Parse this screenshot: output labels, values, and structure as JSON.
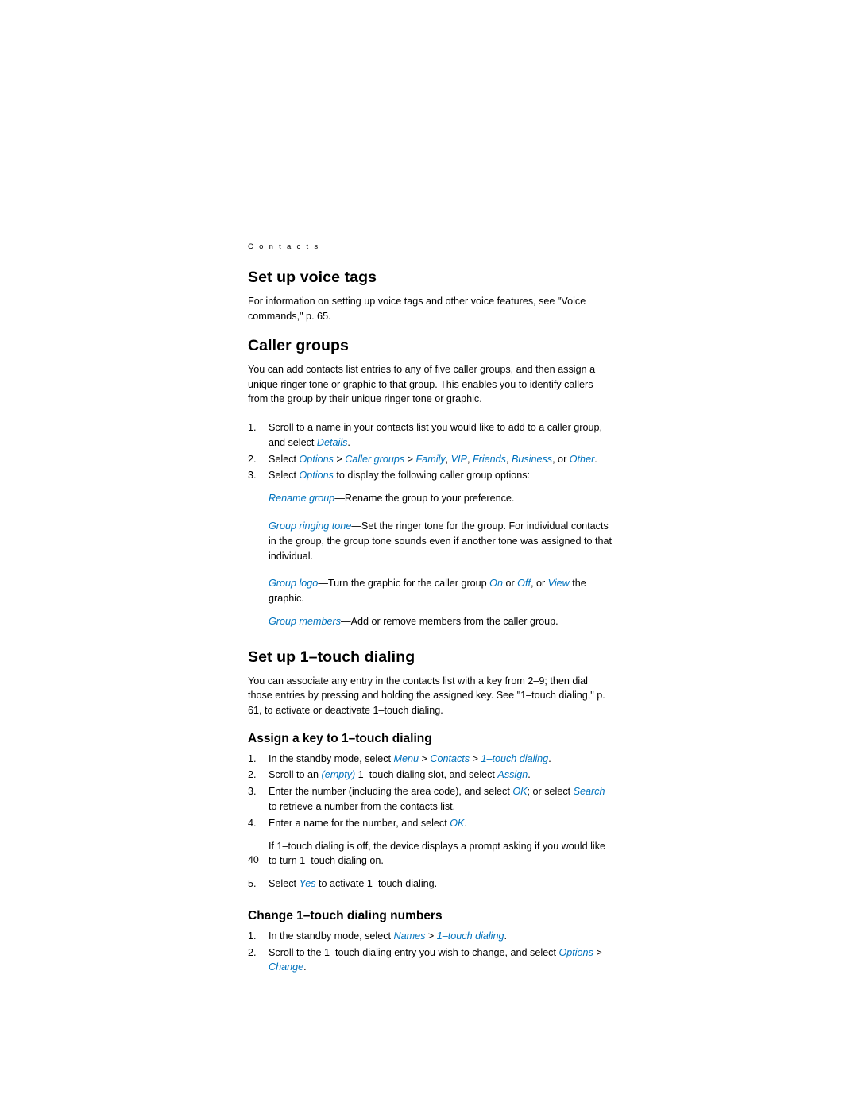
{
  "page": {
    "running_head": "C o n t a c t s",
    "folio": "40",
    "accent_color": "#0072bc"
  },
  "sections": {
    "voice_tags": {
      "title": "Set up voice tags",
      "body": "For information on setting up voice tags and other voice features, see \"Voice commands,\" p. 65."
    },
    "caller_groups": {
      "title": "Caller groups",
      "body": "You can add contacts list entries to any of five caller groups, and then assign a unique ringer tone or graphic to that group. This enables you to identify callers from the group by their unique ringer tone or graphic.",
      "step1": {
        "num": "1.",
        "a": "Scroll to a name in your contacts list you would like to add to a caller group, and select ",
        "link": "Details",
        "b": "."
      },
      "step2": {
        "num": "2.",
        "a": "Select ",
        "l1": "Options",
        "sep1": " > ",
        "l2": "Caller groups",
        "sep2": " > ",
        "l3": "Family",
        "c1": ", ",
        "l4": "VIP",
        "c2": ", ",
        "l5": "Friends",
        "c3": ", ",
        "l6": "Business",
        "c4": ", or ",
        "l7": "Other",
        "end": "."
      },
      "step3": {
        "num": "3.",
        "a": "Select ",
        "link": "Options",
        "b": " to display the following caller group options:"
      },
      "opt_rename": {
        "link": "Rename group",
        "text": "—Rename the group to your preference."
      },
      "opt_ringing": {
        "link": "Group ringing tone",
        "text": "—Set the ringer tone for the group. For individual contacts in the group, the group tone sounds even if another tone was assigned to that individual."
      },
      "opt_logo": {
        "link": "Group logo",
        "a": "—Turn the graphic for the caller group ",
        "l1": "On",
        "b": " or ",
        "l2": "Off",
        "c": ", or ",
        "l3": "View",
        "d": " the graphic."
      },
      "opt_members": {
        "link": "Group members",
        "text": "—Add or remove members from the caller group."
      }
    },
    "one_touch": {
      "title": "Set up 1–touch dialing",
      "body": "You can associate any entry in the contacts list with a key from 2–9; then dial those entries by pressing and holding the assigned key. See \"1–touch dialing,\" p. 61, to activate or deactivate 1–touch dialing.",
      "assign": {
        "title": "Assign a key to 1–touch dialing",
        "step1": {
          "num": "1.",
          "a": "In the standby mode, select ",
          "l1": "Menu",
          "s1": " > ",
          "l2": "Contacts",
          "s2": " > ",
          "l3": "1–touch dialing",
          "end": "."
        },
        "step2": {
          "num": "2.",
          "a": "Scroll to an ",
          "l1": "(empty)",
          "b": " 1–touch dialing slot, and select ",
          "l2": "Assign",
          "end": "."
        },
        "step3": {
          "num": "3.",
          "a": "Enter the number (including the area code), and select ",
          "l1": "OK",
          "b": "; or select ",
          "l2": "Search",
          "c": " to retrieve a number from the contacts list."
        },
        "step4": {
          "num": "4.",
          "a": "Enter a name for the number, and select ",
          "l1": "OK",
          "end": "."
        },
        "note": "If 1–touch dialing is off, the device displays a prompt asking if you would like to turn 1–touch dialing on.",
        "step5": {
          "num": "5.",
          "a": "Select ",
          "l1": "Yes",
          "b": " to activate 1–touch dialing."
        }
      },
      "change": {
        "title": "Change 1–touch dialing numbers",
        "step1": {
          "num": "1.",
          "a": "In the standby mode, select ",
          "l1": "Names",
          "s1": " > ",
          "l2": "1–touch dialing",
          "end": "."
        },
        "step2": {
          "num": "2.",
          "a": "Scroll to the 1–touch dialing entry you wish to change, and select ",
          "l1": "Options",
          "s1": " > ",
          "l2": "Change",
          "end": "."
        }
      }
    }
  }
}
